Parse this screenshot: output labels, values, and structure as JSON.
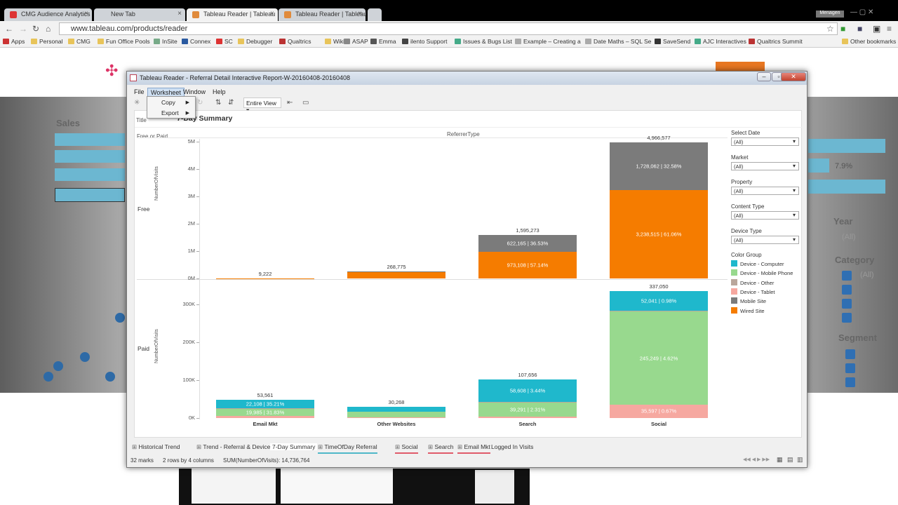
{
  "browser": {
    "tabs": [
      {
        "title": "CMG Audience Analytics"
      },
      {
        "title": "New Tab"
      },
      {
        "title": "Tableau Reader | Tableau"
      },
      {
        "title": "Tableau Reader | Tableau"
      }
    ],
    "url": "www.tableau.com/products/reader",
    "user": "Menagen",
    "bookmarks": [
      "Apps",
      "Personal",
      "CMG",
      "Fun Office Pools",
      "InSite",
      "Connex",
      "SC",
      "Debugger",
      "Qualtrics",
      "Wiki",
      "ASAP",
      "Emma",
      "ilento Support",
      "Issues & Bugs List",
      "Example – Creating a",
      "Date Maths – SQL Se",
      "SaveSend",
      "AJC Interactives",
      "Qualtrics Summit",
      "Other bookmarks"
    ]
  },
  "background_page": {
    "labels": [
      "Sales",
      "Year",
      "Category",
      "Segment"
    ],
    "values": [
      "7.9%",
      "(All)",
      "(All)"
    ]
  },
  "window": {
    "title": "Tableau Reader - Referral Detail Interactive Report-W-20160408-20160408",
    "menu": [
      "File",
      "Worksheet",
      "Window",
      "Help"
    ],
    "worksheet_menu": [
      "Copy",
      "Export"
    ],
    "view_mode": "Entire View"
  },
  "sheet": {
    "title_label": "Title",
    "title": "7-Day Summary",
    "row_header": "Free or Paid",
    "col_header": "ReferrerType",
    "row_free": "Free",
    "row_paid": "Paid",
    "axis_label": "NumberOfVisits",
    "free_ticks": [
      "5M",
      "4M",
      "3M",
      "2M",
      "1M",
      "0M"
    ],
    "paid_ticks": [
      "300K",
      "200K",
      "100K",
      "0K"
    ]
  },
  "chart_data": {
    "type": "bar",
    "categories": [
      "Email Mkt",
      "Other Websites",
      "Search",
      "Social"
    ],
    "xlabel": "ReferrerType",
    "ylabel": "NumberOfVisits",
    "panels": [
      {
        "row": "Free",
        "ylim": [
          0,
          5000000
        ],
        "totals": [
          "9,222",
          "268,775",
          "1,595,273",
          "4,966,577"
        ],
        "series": [
          {
            "name": "Wired Site",
            "color": "#f57c00",
            "values": [
              9222,
              240000,
              973108,
              3238515
            ],
            "labels": [
              "",
              "",
              "973,108 | 57.14%",
              "3,238,515 | 61.06%"
            ]
          },
          {
            "name": "Mobile Site",
            "color": "#7b7b7b",
            "values": [
              0,
              28775,
              622165,
              1728062
            ],
            "labels": [
              "",
              "",
              "622,165 | 36.53%",
              "1,728,062 | 32.58%"
            ]
          }
        ]
      },
      {
        "row": "Paid",
        "ylim": [
          0,
          337050
        ],
        "totals": [
          "53,561",
          "30,268",
          "107,656",
          "337,050"
        ],
        "series": [
          {
            "name": "Device - Tablet",
            "color": "#f6a8a0",
            "values": [
              5000,
              1500,
              3000,
              35597
            ],
            "labels": [
              "",
              "",
              "",
              "35,597 | 0.67%"
            ]
          },
          {
            "name": "Device - Mobile Phone",
            "color": "#98d98e",
            "values": [
              19985,
              15000,
              39291,
              245249
            ],
            "labels": [
              "19,985 | 31.83%",
              "",
              "39,291 | 2.31%",
              "245,249 | 4.62%"
            ]
          },
          {
            "name": "Device - Other",
            "color": "#b9a69b",
            "values": [
              500,
              0,
              1000,
              2000
            ],
            "labels": [
              "",
              "",
              "",
              ""
            ]
          },
          {
            "name": "Device - Computer",
            "color": "#1fb8cc",
            "values": [
              22108,
              13768,
              58608,
              52041
            ],
            "labels": [
              "22,108 | 35.21%",
              "",
              "58,608 | 3.44%",
              "52,041 | 0.98%"
            ]
          }
        ]
      }
    ]
  },
  "filters": [
    {
      "label": "Select Date",
      "value": "(All)"
    },
    {
      "label": "Market",
      "value": "(All)"
    },
    {
      "label": "Property",
      "value": "(All)"
    },
    {
      "label": "Content Type",
      "value": "(All)"
    },
    {
      "label": "Device Type",
      "value": "(All)"
    }
  ],
  "legend": {
    "title": "Color Group",
    "items": [
      {
        "label": "Device - Computer",
        "color": "#1fb8cc"
      },
      {
        "label": "Device - Mobile Phone",
        "color": "#98d98e"
      },
      {
        "label": "Device - Other",
        "color": "#b9a69b"
      },
      {
        "label": "Device - Tablet",
        "color": "#f6a8a0"
      },
      {
        "label": "Mobile Site",
        "color": "#7b7b7b"
      },
      {
        "label": "Wired Site",
        "color": "#f57c00"
      }
    ]
  },
  "sheet_tabs": [
    "Historical Trend",
    "Trend - Referral & Device",
    "7-Day Summary",
    "TimeOfDay Referral",
    "Social",
    "Search",
    "Email Mkt",
    "Logged In Visits"
  ],
  "status": {
    "marks": "32 marks",
    "dims": "2 rows by 4 columns",
    "sum": "SUM(NumberOfVisits): 14,736,764"
  }
}
